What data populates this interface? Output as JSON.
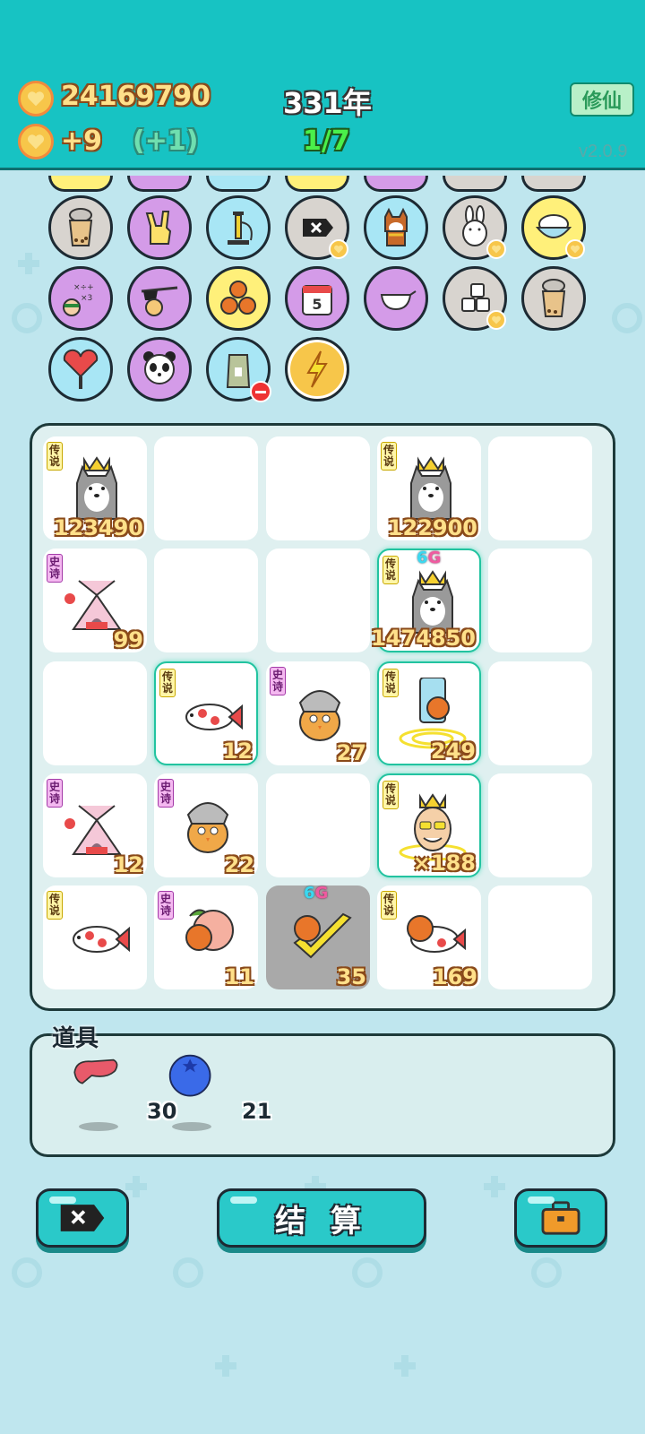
{
  "header": {
    "coins": "24169790",
    "income": "+9",
    "income_bonus": "(+1)",
    "year": "331年",
    "progress": "1/7",
    "cultivate_label": "修仙",
    "version": "v2.0.9"
  },
  "items_row1": [
    "bubble-tea-icon",
    "rock-hand-icon",
    "bike-pump-icon",
    "delete-tag-icon",
    "shiba-dog-icon",
    "bunny-icon",
    "rice-bowl-icon"
  ],
  "items_row2": [
    "math-kid-icon",
    "glasses-icon",
    "basketball-triple-icon",
    "calendar-icon",
    "gravy-boat-icon",
    "sugar-cubes-icon",
    "bubble-tea-icon"
  ],
  "items_row3": [
    "heart-fan-icon",
    "panda-icon",
    "rice-bag-icon",
    "lightning-icon"
  ],
  "calendar_number": "5",
  "tags": {
    "legend": "传说",
    "epic": "史诗"
  },
  "board": {
    "cells": [
      {
        "tag": "传说",
        "value": "123490",
        "icon": "husky-king-icon"
      },
      {
        "tag": "",
        "value": "",
        "icon": ""
      },
      {
        "tag": "",
        "value": "",
        "icon": ""
      },
      {
        "tag": "传说",
        "value": "122900",
        "icon": "husky-king-icon"
      },
      {
        "tag": "",
        "value": "",
        "icon": ""
      },
      {
        "tag": "史诗",
        "value": "99",
        "icon": "rabbit-tent-icon"
      },
      {
        "tag": "",
        "value": "",
        "icon": ""
      },
      {
        "tag": "",
        "value": "",
        "icon": ""
      },
      {
        "tag": "传说",
        "value": "1474850",
        "icon": "husky-king-icon",
        "badge": "6G"
      },
      {
        "tag": "",
        "value": "",
        "icon": ""
      },
      {
        "tag": "",
        "value": "",
        "icon": ""
      },
      {
        "tag": "传说",
        "value": "12",
        "icon": "koi-fish-icon"
      },
      {
        "tag": "史诗",
        "value": "27",
        "icon": "grandpa-chick-icon"
      },
      {
        "tag": "传说",
        "value": "249",
        "icon": "fridge-vortex-icon"
      },
      {
        "tag": "",
        "value": "",
        "icon": ""
      },
      {
        "tag": "史诗",
        "value": "12",
        "icon": "rabbit-tent-icon"
      },
      {
        "tag": "史诗",
        "value": "22",
        "icon": "grandpa-chick-icon"
      },
      {
        "tag": "",
        "value": "",
        "icon": ""
      },
      {
        "tag": "传说",
        "value": "×188",
        "icon": "king-face-icon"
      },
      {
        "tag": "",
        "value": "",
        "icon": ""
      },
      {
        "tag": "传说",
        "value": "",
        "icon": "koi-fish-icon"
      },
      {
        "tag": "史诗",
        "value": "11",
        "icon": "peach-icon"
      },
      {
        "tag": "",
        "value": "35",
        "icon": "check-ball-icon",
        "badge": "6G"
      },
      {
        "tag": "传说",
        "value": "169",
        "icon": "koi-fish-ball-icon"
      },
      {
        "tag": "",
        "value": "",
        "icon": ""
      }
    ]
  },
  "props": {
    "title": "道具",
    "items": [
      {
        "icon": "liver-icon",
        "count": "30"
      },
      {
        "icon": "blueberry-icon",
        "count": "21"
      }
    ]
  },
  "buttons": {
    "settle_label": "结 算"
  },
  "colors": {
    "header": "#17c3c3",
    "background": "#bfe6ee",
    "gold": "#ffe08a",
    "accent": "#2ac9c9"
  }
}
